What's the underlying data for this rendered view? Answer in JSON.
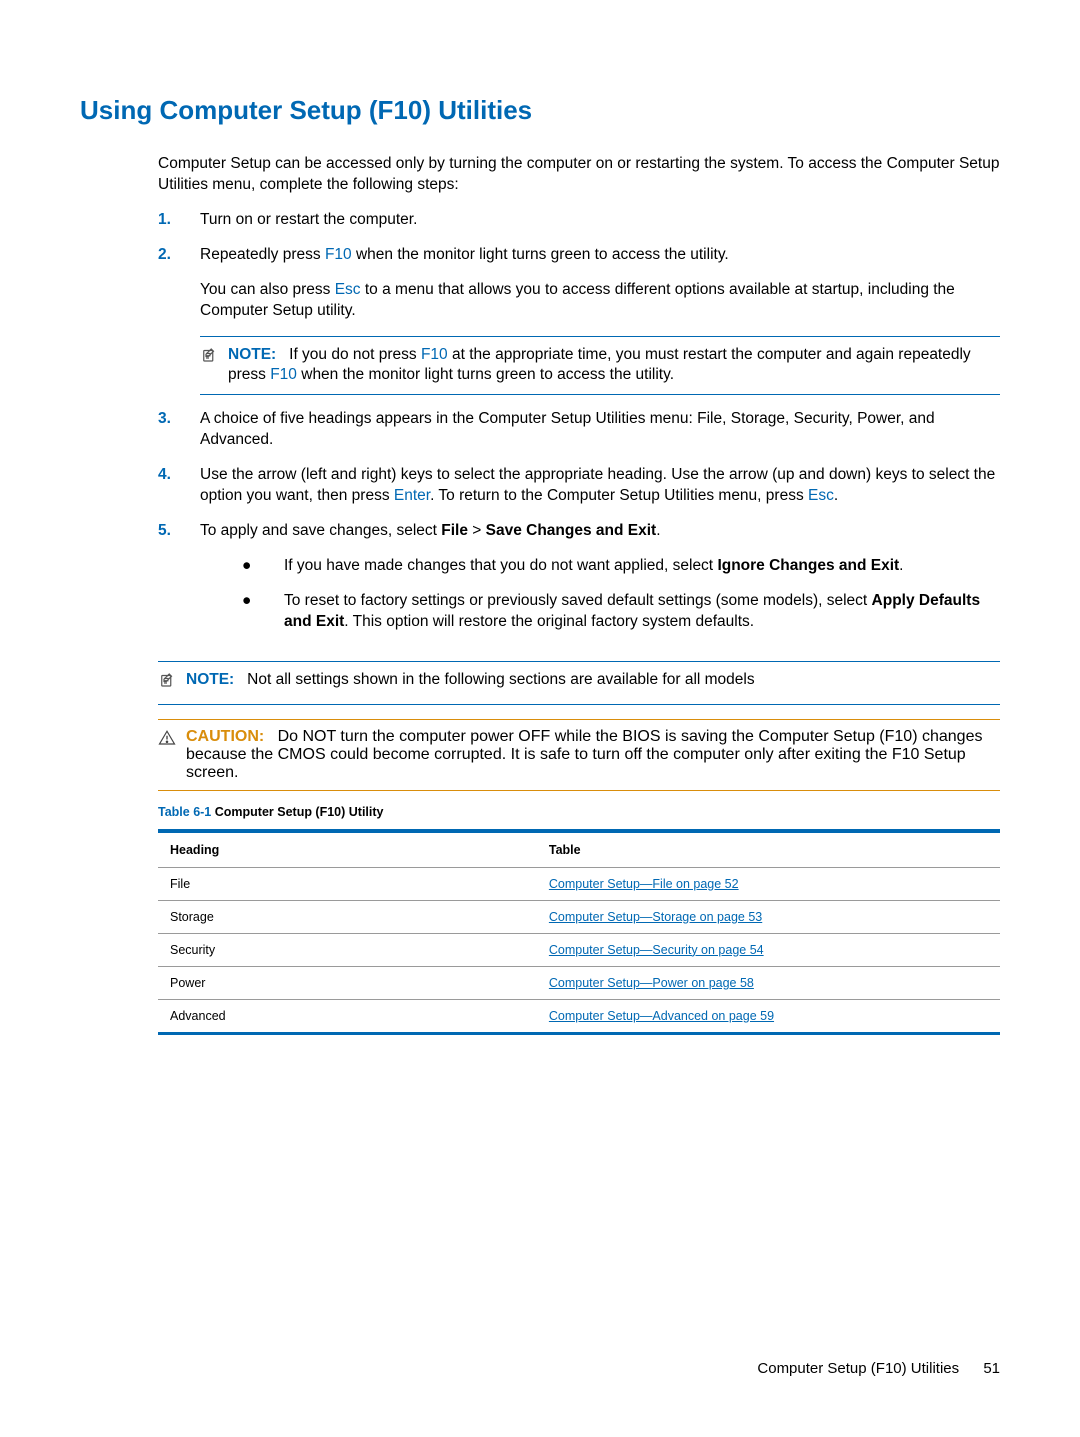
{
  "page_title": "Using Computer Setup (F10) Utilities",
  "intro": "Computer Setup can be accessed only by turning the computer on or restarting the system. To access the Computer Setup Utilities menu, complete the following steps:",
  "steps": {
    "s1": "Turn on or restart the computer.",
    "s2a": "Repeatedly press ",
    "s2_key1": "F10",
    "s2b": " when the monitor light turns green to access the utility.",
    "s2c": "You can also press ",
    "s2_key2": "Esc",
    "s2d": " to a menu that allows you to access different options available at startup, including the Computer Setup utility.",
    "s3": "A choice of five headings appears in the Computer Setup Utilities menu: File, Storage, Security, Power, and Advanced.",
    "s4a": "Use the arrow (left and right) keys to select the appropriate heading. Use the arrow (up and down) keys to select the option you want, then press ",
    "s4_key1": "Enter",
    "s4b": ". To return to the Computer Setup Utilities menu, press ",
    "s4_key2": "Esc",
    "s4c": ".",
    "s5a": "To apply and save changes, select ",
    "s5_b1": "File",
    "s5_gt": " > ",
    "s5_b2": "Save Changes and Exit",
    "s5_dot": ".",
    "b1a": "If you have made changes that you do not want applied, select ",
    "b1b": "Ignore Changes and Exit",
    "b1c": ".",
    "b2a": "To reset to factory settings or previously saved default settings (some models), select ",
    "b2b": "Apply Defaults and Exit",
    "b2c": ". This option will restore the original factory system defaults."
  },
  "note1": {
    "label": "NOTE:",
    "t1": "If you do not press ",
    "k1": "F10",
    "t2": " at the appropriate time, you must restart the computer and again repeatedly press ",
    "k2": "F10",
    "t3": " when the monitor light turns green to access the utility."
  },
  "note2": {
    "label": "NOTE:",
    "text": "Not all settings shown in the following sections are available for all models"
  },
  "caution": {
    "label": "CAUTION:",
    "text": "Do NOT turn the computer power OFF while the BIOS is saving the Computer Setup (F10) changes because the CMOS could become corrupted. It is safe to turn off the computer only after exiting the F10 Setup screen."
  },
  "table": {
    "caption_label": "Table 6-1",
    "caption_text": "  Computer Setup (F10) Utility",
    "headers": [
      "Heading",
      "Table"
    ],
    "rows": [
      {
        "heading": "File",
        "link": "Computer Setup—File on page 52"
      },
      {
        "heading": "Storage",
        "link": "Computer Setup—Storage on page 53"
      },
      {
        "heading": "Security",
        "link": "Computer Setup—Security on page 54"
      },
      {
        "heading": "Power",
        "link": "Computer Setup—Power on page 58"
      },
      {
        "heading": "Advanced",
        "link": "Computer Setup—Advanced on page 59"
      }
    ]
  },
  "footer": {
    "title": "Computer Setup (F10) Utilities",
    "page": "51"
  }
}
